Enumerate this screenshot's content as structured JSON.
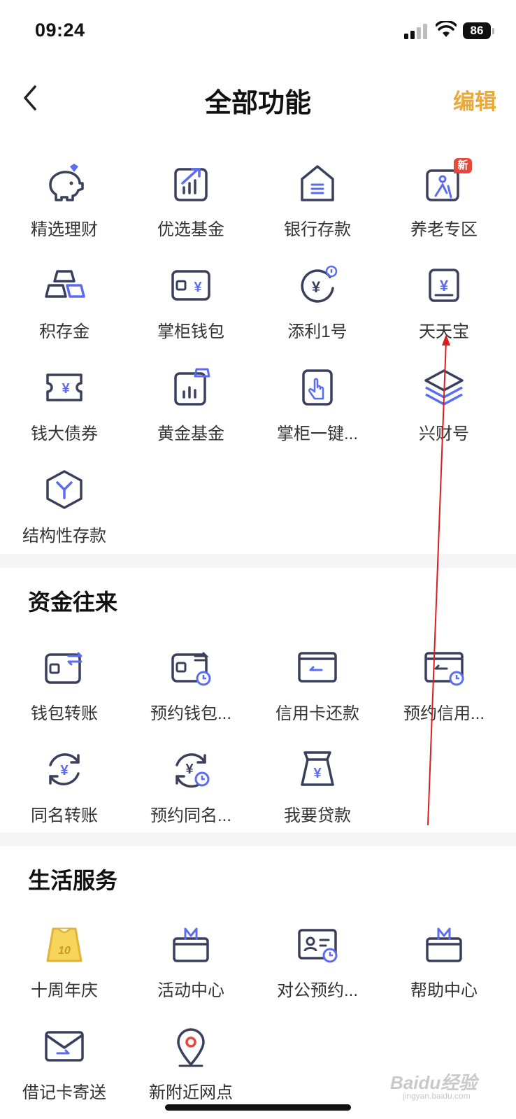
{
  "status": {
    "time": "09:24",
    "battery": "86"
  },
  "nav": {
    "title": "全部功能",
    "edit": "编辑"
  },
  "wealth": {
    "items": [
      {
        "label": "精选理财",
        "icon": "piggy-bank-icon"
      },
      {
        "label": "优选基金",
        "icon": "fund-chart-icon"
      },
      {
        "label": "银行存款",
        "icon": "bank-house-icon"
      },
      {
        "label": "养老专区",
        "icon": "elderly-icon",
        "badge": "新"
      },
      {
        "label": "积存金",
        "icon": "gold-bars-icon"
      },
      {
        "label": "掌柜钱包",
        "icon": "wallet-yen-icon"
      },
      {
        "label": "添利1号",
        "icon": "yen-coin-icon"
      },
      {
        "label": "天天宝",
        "icon": "yen-document-icon"
      },
      {
        "label": "钱大债券",
        "icon": "bond-ticket-icon"
      },
      {
        "label": "黄金基金",
        "icon": "gold-fund-icon"
      },
      {
        "label": "掌柜一键...",
        "icon": "tap-finger-icon"
      },
      {
        "label": "兴财号",
        "icon": "layers-icon"
      },
      {
        "label": "结构性存款",
        "icon": "hexagon-y-icon"
      }
    ]
  },
  "transfer": {
    "title": "资金往来",
    "items": [
      {
        "label": "钱包转账",
        "icon": "wallet-transfer-icon"
      },
      {
        "label": "预约钱包...",
        "icon": "wallet-schedule-icon"
      },
      {
        "label": "信用卡还款",
        "icon": "credit-card-icon"
      },
      {
        "label": "预约信用...",
        "icon": "credit-card-schedule-icon"
      },
      {
        "label": "同名转账",
        "icon": "yen-cycle-icon"
      },
      {
        "label": "预约同名...",
        "icon": "yen-cycle-schedule-icon"
      },
      {
        "label": "我要贷款",
        "icon": "loan-bag-icon"
      }
    ]
  },
  "life": {
    "title": "生活服务",
    "items": [
      {
        "label": "十周年庆",
        "icon": "anniversary-icon"
      },
      {
        "label": "活动中心",
        "icon": "gift-box-icon"
      },
      {
        "label": "对公预约...",
        "icon": "id-card-schedule-icon"
      },
      {
        "label": "帮助中心",
        "icon": "gift-box-icon"
      },
      {
        "label": "借记卡寄送",
        "icon": "envelope-icon"
      },
      {
        "label": "新附近网点",
        "icon": "location-pin-icon"
      }
    ]
  },
  "watermark": {
    "text": "Baidu经验",
    "sub": "jingyan.baidu.com"
  },
  "colors": {
    "icon": "#3a3f5c",
    "accent": "#5b6cf0",
    "edit": "#e8a93c",
    "badge": "#e8483c",
    "gold": "#e8c04a"
  }
}
